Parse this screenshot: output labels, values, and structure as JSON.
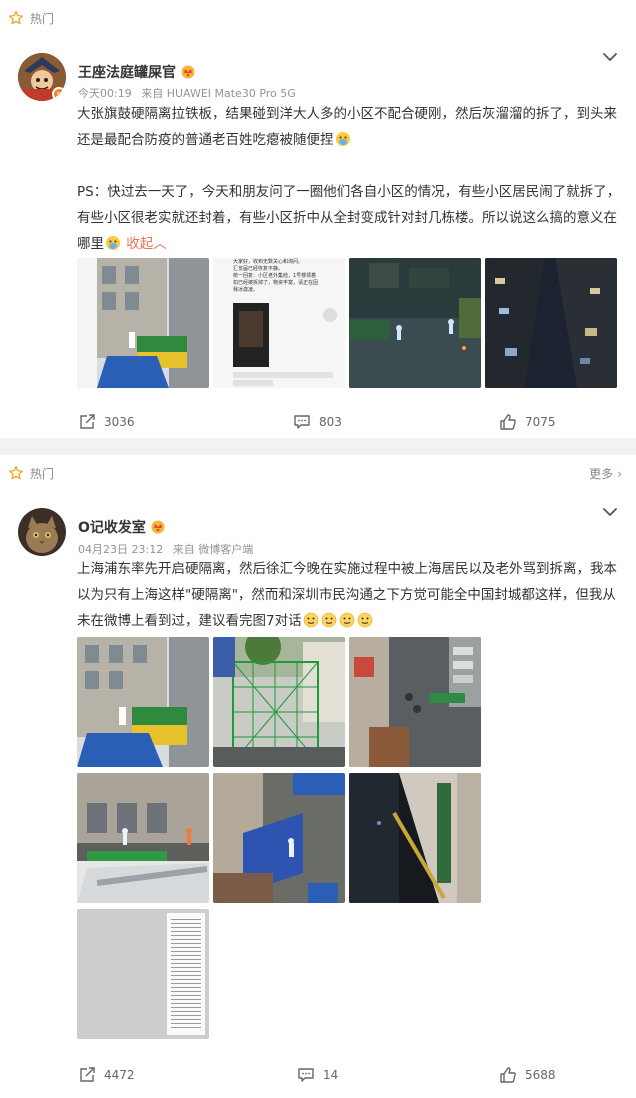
{
  "posts": [
    {
      "hot_label": "热门",
      "username": "王座法庭罐屎官",
      "time": "今天00:19",
      "source": "来自 HUAWEI Mate30 Pro 5G",
      "text1": "大张旗鼓硬隔离拉铁板，结果碰到洋大人多的小区不配合硬刚，然后灰溜溜的拆了，到头来还是最配合防疫的普通老百姓吃瘪被随便捏",
      "text2": "PS：快过去一天了，今天和朋友问了一圈他们各自小区的情况，有些小区居民闹了就拆了，有些小区很老实就还封着，有些小区折中从全封变成针对封几栋楼。所以说这么搞的意义在哪里",
      "collapse_label": "收起",
      "image_text": {
        "line1": "大家好，收到无数关心和询问。",
        "line2": "汇览届已经恢复平静。",
        "line3": "统一回复：小区老外集结，1号楼领着",
        "line4": "扣已经被拆掉了，物资丰富，请正在固",
        "line5": "我冰激凌。"
      },
      "share_count": "3036",
      "comment_count": "803",
      "like_count": "7075"
    },
    {
      "hot_label": "热门",
      "more_label": "更多",
      "username": "O记收发室",
      "time": "04月23日 23:12",
      "source": "来自 微博客户端",
      "text": "上海浦东率先开启硬隔离，然后徐汇今晚在实施过程中被上海居民以及老外骂到拆离，我本以为只有上海这样\"硬隔离\"，然而和深圳市民沟通之下方觉可能全中国封城都这样，但我从未在微博上看到过，建议看完图7对话",
      "share_count": "4472",
      "comment_count": "14",
      "like_count": "5688"
    }
  ],
  "colors": {
    "accent": "#eb7350",
    "hot_star": "#f5a623",
    "meta_gray": "#939393",
    "separator": "#f2f2f2"
  },
  "icons": [
    "star-icon",
    "chevron-down-icon",
    "share-icon",
    "comment-icon",
    "like-icon",
    "crown-badge-icon",
    "emoji-icon"
  ]
}
